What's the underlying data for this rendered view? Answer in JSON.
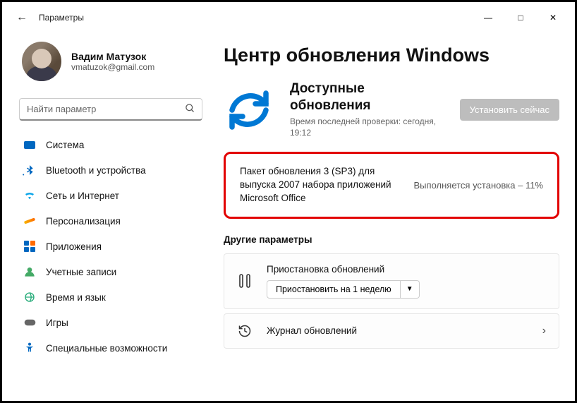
{
  "titlebar": {
    "app_title": "Параметры"
  },
  "profile": {
    "name": "Вадим Матузок",
    "email": "vmatuzok@gmail.com"
  },
  "search": {
    "placeholder": "Найти параметр"
  },
  "nav": [
    {
      "label": "Система"
    },
    {
      "label": "Bluetooth и устройства"
    },
    {
      "label": "Сеть и Интернет"
    },
    {
      "label": "Персонализация"
    },
    {
      "label": "Приложения"
    },
    {
      "label": "Учетные записи"
    },
    {
      "label": "Время и язык"
    },
    {
      "label": "Игры"
    },
    {
      "label": "Специальные возможности"
    }
  ],
  "main": {
    "title": "Центр обновления Windows",
    "header": {
      "title": "Доступные обновления",
      "subtitle": "Время последней проверки: сегодня, 19:12",
      "button": "Установить сейчас"
    },
    "update_item": {
      "name": "Пакет обновления 3 (SP3) для выпуска 2007 набора приложений Microsoft Office",
      "status": "Выполняется установка – 11%"
    },
    "other_title": "Другие параметры",
    "pause": {
      "label": "Приостановка обновлений",
      "button": "Приостановить на 1 неделю"
    },
    "history": {
      "label": "Журнал обновлений"
    }
  }
}
